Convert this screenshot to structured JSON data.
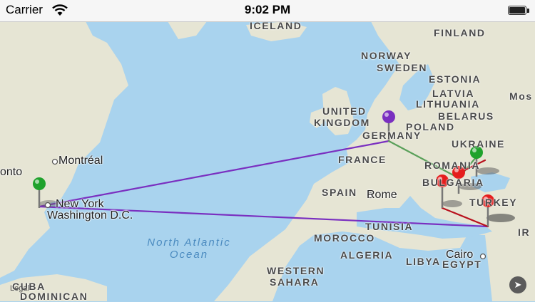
{
  "status_bar": {
    "carrier": "Carrier",
    "time": "9:02 PM",
    "battery_level": 1.0,
    "wifi_icon": "wifi-icon",
    "battery_icon": "battery-icon"
  },
  "map": {
    "ocean_label": [
      "North Atlantic",
      "Ocean"
    ],
    "legal_label": "Legal",
    "compass_icon": "location-arrow-icon",
    "countries": {
      "iceland": "ICELAND",
      "finland": "FINLAND",
      "norway": "NORWAY",
      "sweden": "SWEDEN",
      "estonia": "ESTONIA",
      "latvia": "LATVIA",
      "lithuania": "LITHUANIA",
      "mos": "Mos",
      "uk": [
        "UNITED",
        "KINGDOM"
      ],
      "belarus": "BELARUS",
      "poland": "POLAND",
      "germany": "GERMANY",
      "ukraine": "UKRAINE",
      "france": "FRANCE",
      "romania": "ROMANIA",
      "spain": "SPAIN",
      "bulgaria": "BULGARIA",
      "turkey": "TURKEY",
      "tunisia": "TUNISIA",
      "morocco": "MOROCCO",
      "algeria": "ALGERIA",
      "libya": "LIBYA",
      "egypt": "EGYPT",
      "western_sahara": [
        "WESTERN",
        "SAHARA"
      ],
      "cuba": "CUBA",
      "dominican": "DOMINICAN",
      "ir": "IR"
    },
    "cities": {
      "montreal": "Montréal",
      "toronto": "onto",
      "new_york": "New York",
      "washington": "Washington D.C.",
      "rome": "Rome",
      "cairo": "Cairo"
    },
    "pins": [
      {
        "name": "pin-green-usa",
        "color": "#1fa22c"
      },
      {
        "name": "pin-purple-germany",
        "color": "#7a2fc0"
      },
      {
        "name": "pin-green-ukraine",
        "color": "#1fa22c"
      },
      {
        "name": "pin-red-romania",
        "color": "#e51d1d"
      },
      {
        "name": "pin-red-bulgaria",
        "color": "#e51d1d"
      },
      {
        "name": "pin-red-turkey",
        "color": "#e51d1d"
      }
    ],
    "route_colors": {
      "purple": "#7a2fc0",
      "green": "#5aa05a",
      "red": "#b8101c"
    }
  }
}
